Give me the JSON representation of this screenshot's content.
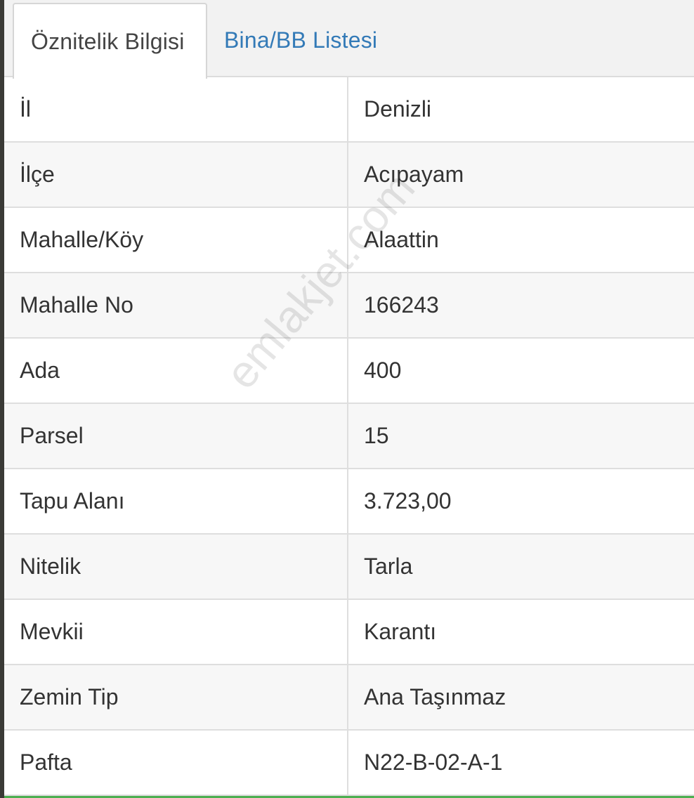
{
  "tabs": [
    {
      "label": "Öznitelik Bilgisi",
      "active": true
    },
    {
      "label": "Bina/BB Listesi",
      "active": false
    }
  ],
  "rows": [
    {
      "key": "İl",
      "value": "Denizli"
    },
    {
      "key": "İlçe",
      "value": "Acıpayam"
    },
    {
      "key": "Mahalle/Köy",
      "value": "Alaattin"
    },
    {
      "key": "Mahalle No",
      "value": "166243"
    },
    {
      "key": "Ada",
      "value": "400"
    },
    {
      "key": "Parsel",
      "value": "15"
    },
    {
      "key": "Tapu Alanı",
      "value": "3.723,00"
    },
    {
      "key": "Nitelik",
      "value": "Tarla"
    },
    {
      "key": "Mevkii",
      "value": "Karantı"
    },
    {
      "key": "Zemin Tip",
      "value": "Ana Taşınmaz"
    },
    {
      "key": "Pafta",
      "value": "N22-B-02-A-1"
    }
  ],
  "watermark": "emlakjet.com",
  "colors": {
    "tab_link": "#337ab7",
    "text": "#333333",
    "border": "#dedede"
  }
}
